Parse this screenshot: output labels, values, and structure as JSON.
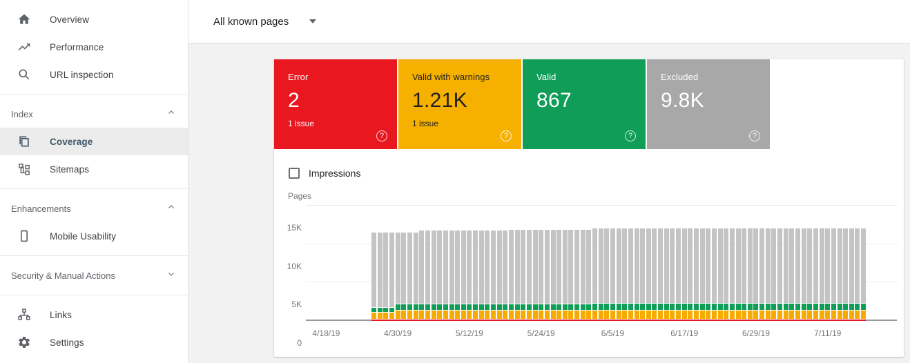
{
  "topbar": {
    "page_filter_label": "All known pages"
  },
  "icons": {
    "help": "?",
    "dropdown": "caret-down"
  },
  "sidebar": {
    "selected_item": "Coverage",
    "groups": [
      {
        "items": [
          {
            "icon": "home-icon",
            "label": "Overview"
          },
          {
            "icon": "trending-up-icon",
            "label": "Performance"
          },
          {
            "icon": "search-icon",
            "label": "URL inspection"
          }
        ]
      },
      {
        "header": "Index",
        "chevron": "up",
        "items": [
          {
            "icon": "pages-icon",
            "label": "Coverage",
            "selected": true
          },
          {
            "icon": "sitemap-icon",
            "label": "Sitemaps"
          }
        ]
      },
      {
        "header": "Enhancements",
        "chevron": "up",
        "items": [
          {
            "icon": "smartphone-icon",
            "label": "Mobile Usability"
          }
        ]
      },
      {
        "header": "Security & Manual Actions",
        "chevron": "down",
        "items": []
      },
      {
        "items": [
          {
            "icon": "links-icon",
            "label": "Links"
          },
          {
            "icon": "gear-icon",
            "label": "Settings"
          }
        ]
      }
    ]
  },
  "cards": [
    {
      "label": "Error",
      "value": "2",
      "sub": "1 issue",
      "color": "#e9171f",
      "text_color": "#ffffff"
    },
    {
      "label": "Valid with warnings",
      "value": "1.21K",
      "sub": "1 issue",
      "color": "#f6b000",
      "text_color": "#1f1f1f"
    },
    {
      "label": "Valid",
      "value": "867",
      "sub": "",
      "color": "#0f9d58",
      "text_color": "#ffffff"
    },
    {
      "label": "Excluded",
      "value": "9.8K",
      "sub": "",
      "color": "#a8a8a8",
      "text_color": "#ffffff"
    }
  ],
  "impressions": {
    "label": "Impressions",
    "checked": false
  },
  "chart_data": {
    "type": "stacked-bar",
    "ylabel": "Pages",
    "ylim": [
      0,
      15000
    ],
    "grid": true,
    "yticks": [
      {
        "label": "15K",
        "value": 15000
      },
      {
        "label": "10K",
        "value": 10000
      },
      {
        "label": "5K",
        "value": 5000
      },
      {
        "label": "0",
        "value": 0
      }
    ],
    "xticks": [
      "4/18/19",
      "4/30/19",
      "5/12/19",
      "5/24/19",
      "6/5/19",
      "6/17/19",
      "6/29/19",
      "7/11/19"
    ],
    "x_axis": {
      "start": "4/15/19",
      "end": "7/23/19"
    },
    "series_stack_order_bottom_to_top": [
      "errors",
      "warnings",
      "valid",
      "excluded"
    ],
    "series_names": {
      "errors": "Error",
      "warnings": "Valid with warnings",
      "valid": "Valid",
      "excluded": "Excluded"
    },
    "colors": {
      "errors": "#e9171f",
      "warnings": "#f7ab00",
      "valid": "#0f9d58",
      "excluded": "#c4c4c4"
    },
    "bars": {
      "start_date": "4/26/19",
      "end_date": "7/17/19",
      "segments": [
        {
          "days": 4,
          "errors": 2,
          "warnings": 900,
          "valid": 650,
          "excluded": 9750
        },
        {
          "days": 4,
          "errors": 2,
          "warnings": 1150,
          "valid": 820,
          "excluded": 9330
        },
        {
          "days": 15,
          "errors": 2,
          "warnings": 1150,
          "valid": 820,
          "excluded": 9630
        },
        {
          "days": 14,
          "errors": 2,
          "warnings": 1150,
          "valid": 820,
          "excluded": 9730
        },
        {
          "days": 46,
          "errors": 2,
          "warnings": 1210,
          "valid": 867,
          "excluded": 9800
        }
      ]
    }
  }
}
